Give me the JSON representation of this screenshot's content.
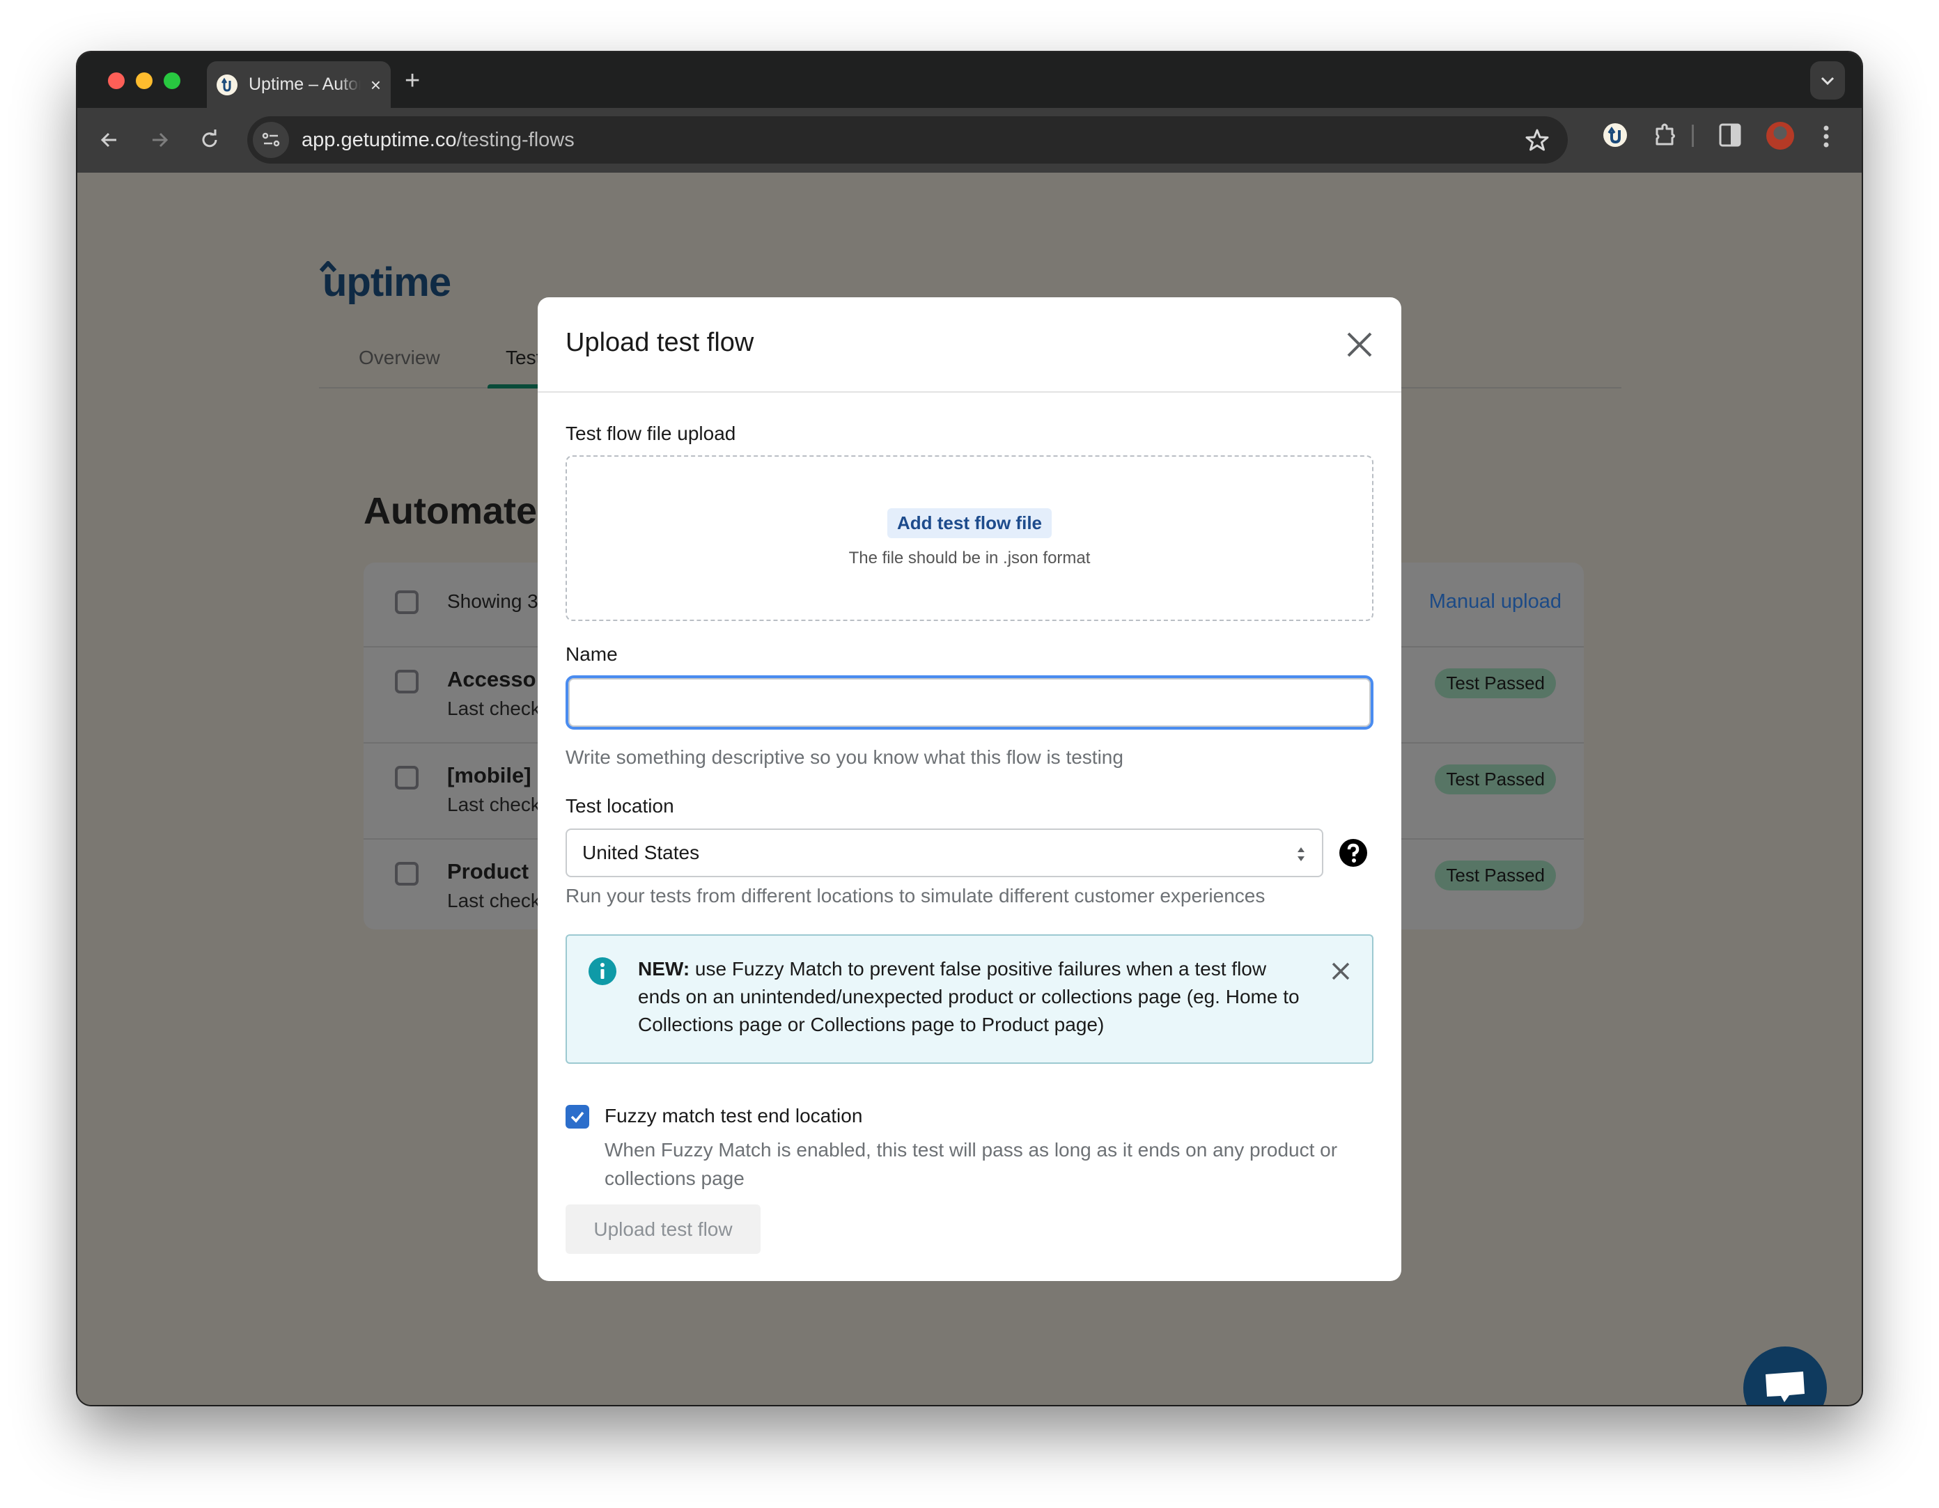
{
  "browser": {
    "tab_title": "Uptime – Automated store testing",
    "tab_close": "×",
    "new_tab": "+",
    "url_host": "app.getuptime.co",
    "url_path": "/testing-flows"
  },
  "page": {
    "logo": "uptime",
    "tabs": [
      {
        "label": "Overview",
        "active": false
      },
      {
        "label": "Test",
        "active": true
      }
    ],
    "heading": "Automate",
    "list": {
      "showing": "Showing 3",
      "manual_upload": "Manual upload",
      "rows": [
        {
          "title": "Accesso",
          "subtitle": "Last check",
          "status": "Test Passed"
        },
        {
          "title": "[mobile]",
          "subtitle": "Last check",
          "status": "Test Passed"
        },
        {
          "title": "Product",
          "subtitle": "Last check",
          "status": "Test Passed"
        }
      ]
    },
    "colors": {
      "brand": "#0f2a44",
      "tab_active": "#0a4b39",
      "badge_success": "#577565",
      "chat_button": "#0f3a5e"
    }
  },
  "modal": {
    "title": "Upload test flow",
    "file_upload": {
      "label": "Test flow file upload",
      "button": "Add test flow file",
      "hint": "The file should be in .json format"
    },
    "name": {
      "label": "Name",
      "value": "",
      "placeholder": "",
      "help": "Write something descriptive so you know what this flow is testing"
    },
    "location": {
      "label": "Test location",
      "selected": "United States",
      "help": "Run your tests from different locations to simulate different customer experiences"
    },
    "banner": {
      "strong": "NEW:",
      "text": " use Fuzzy Match to prevent false positive failures when a test flow ends on an unintended/unexpected product or collections page (eg. Home to Collections page or Collections page to Product page)"
    },
    "fuzzy": {
      "checked": true,
      "label": "Fuzzy match test end location",
      "description": "When Fuzzy Match is enabled, this test will pass as long as it ends on any product or collections page"
    },
    "submit": "Upload test flow",
    "colors": {
      "focus": "#4a8cf0",
      "checkbox": "#2c6ecb",
      "banner_bg": "#eaf7fa",
      "info_icon": "#0f9aa7"
    }
  }
}
